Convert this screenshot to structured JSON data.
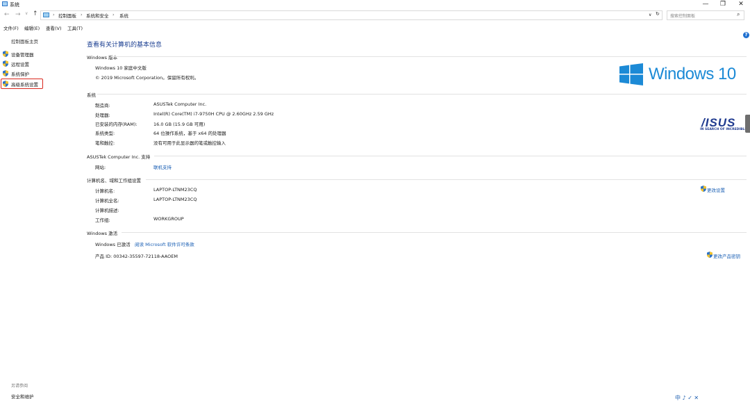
{
  "window": {
    "title": "系统",
    "min_glyph": "—",
    "max_glyph": "❐",
    "close_glyph": "✕"
  },
  "nav": {
    "back_glyph": "←",
    "forward_glyph": "→",
    "recent_glyph": "∨",
    "up_glyph": "↑",
    "breadcrumbs": [
      "控制面板",
      "系统和安全",
      "系统"
    ],
    "sep": "›",
    "dropdown_glyph": "∨",
    "refresh_glyph": "↻",
    "search_placeholder": "搜索控制面板",
    "search_glyph": "⌕"
  },
  "menu": [
    "文件(F)",
    "编辑(E)",
    "查看(V)",
    "工具(T)"
  ],
  "sidebar": {
    "home": "控制面板主页",
    "items": [
      {
        "label": "设备管理器"
      },
      {
        "label": "远程设置"
      },
      {
        "label": "系统保护"
      },
      {
        "label": "高级系统设置"
      }
    ],
    "see_also": "另请参阅",
    "see_also_items": [
      "安全和维护"
    ]
  },
  "main": {
    "heading": "查看有关计算机的基本信息",
    "edition": {
      "title": "Windows 版本",
      "name": "Windows 10 家庭中文版",
      "copyright": "© 2019 Microsoft Corporation。保留所有权利。",
      "brand_text": "Windows 10"
    },
    "system": {
      "title": "系统",
      "rows": [
        {
          "label": "制造商:",
          "value": "ASUSTek Computer Inc."
        },
        {
          "label": "处理器:",
          "value": "Intel(R) Core(TM) i7-9750H CPU @ 2.60GHz   2.59 GHz"
        },
        {
          "label": "已安装的内存(RAM):",
          "value": "16.0 GB (15.9 GB 可用)"
        },
        {
          "label": "系统类型:",
          "value": "64 位操作系统，基于 x64 的处理器"
        },
        {
          "label": "笔和触控:",
          "value": "没有可用于此显示器的笔或触控输入"
        }
      ],
      "oem_logo": "/ISUS",
      "oem_tagline": "IN SEARCH OF INCREDIBLE"
    },
    "support": {
      "title": "ASUSTek Computer Inc. 支持",
      "rows": [
        {
          "label": "网站:",
          "value": "联机支持"
        }
      ]
    },
    "computer": {
      "title": "计算机名、域和工作组设置",
      "rows": [
        {
          "label": "计算机名:",
          "value": "LAPTOP-LTNM23CQ"
        },
        {
          "label": "计算机全名:",
          "value": "LAPTOP-LTNM23CQ"
        },
        {
          "label": "计算机描述:",
          "value": ""
        },
        {
          "label": "工作组:",
          "value": "WORKGROUP"
        }
      ],
      "change_settings": "更改设置"
    },
    "activation": {
      "title": "Windows 激活",
      "status": "Windows 已激活",
      "license_link": "阅读 Microsoft 软件许可条款",
      "product_id": "产品 ID: 00342-35597-72118-AAOEM",
      "change_key": "更改产品密钥"
    }
  },
  "help_glyph": "?",
  "ime": {
    "text": "中 ♪ ✓ ✕"
  },
  "colors": {
    "accent": "#1a5fb4",
    "heading": "#1b3f91",
    "win_blue": "#1c8ad6",
    "asus_blue": "#1f3a8f",
    "highlight_red": "#d9261c"
  }
}
